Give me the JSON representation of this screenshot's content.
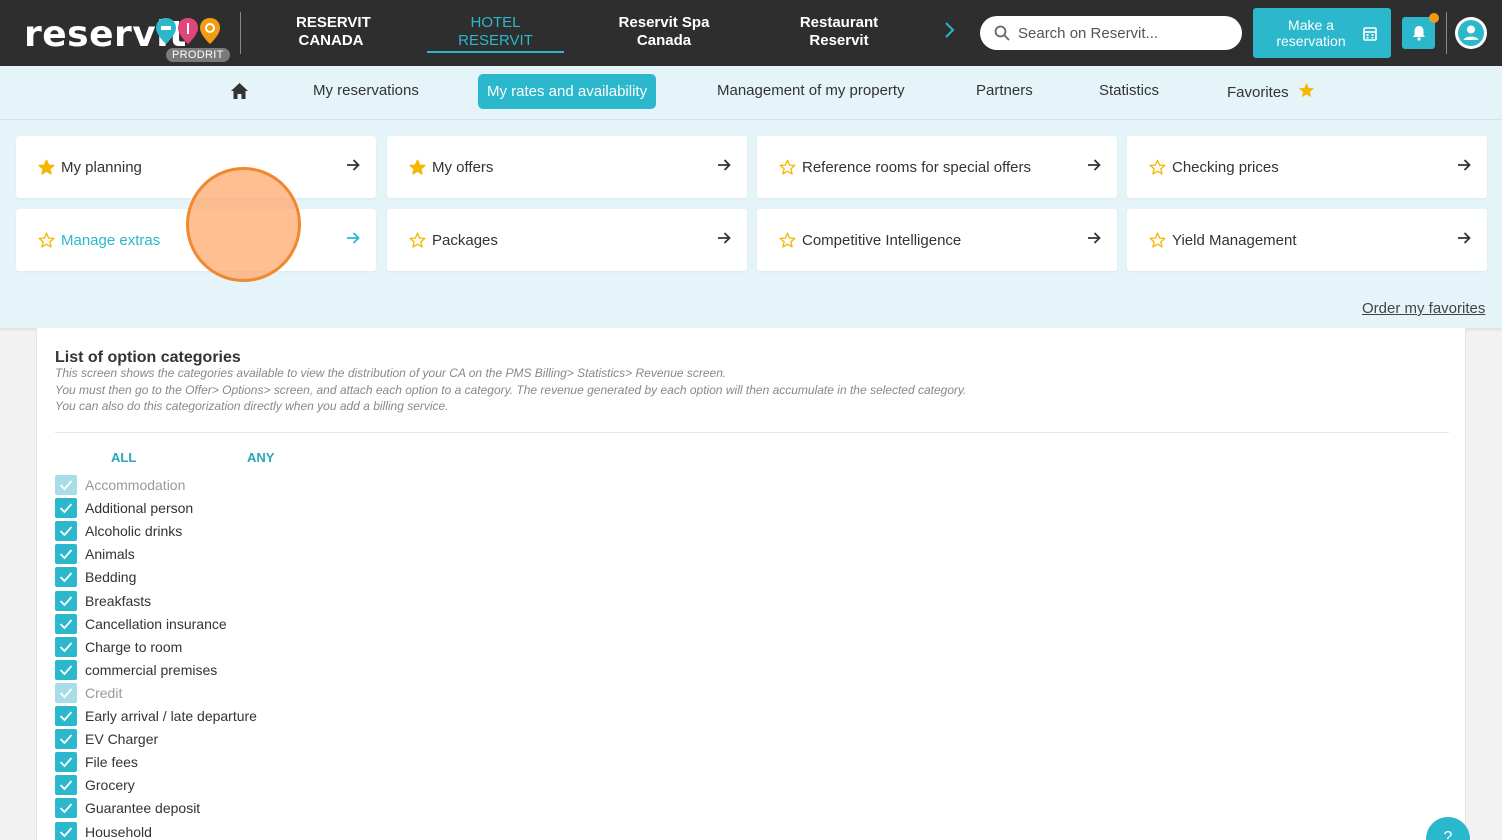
{
  "brand": {
    "logo_text": "reservit",
    "badge": "PRODRIT"
  },
  "top_nav": [
    {
      "line1": "RESERVIT",
      "line2": "CANADA"
    },
    {
      "line1": "HOTEL",
      "line2": "RESERVIT"
    },
    {
      "line1": "Reservit Spa",
      "line2": "Canada"
    },
    {
      "line1": "Restaurant",
      "line2": "Reservit"
    }
  ],
  "search": {
    "placeholder": "Search on Reservit..."
  },
  "make_reservation": {
    "line1": "Make a",
    "line2": "reservation"
  },
  "sub_nav": {
    "items": [
      "My reservations",
      "My rates and availability",
      "Management of my property",
      "Partners",
      "Statistics",
      "Favorites"
    ]
  },
  "favorites": {
    "cards": [
      {
        "label": "My planning",
        "starred": true
      },
      {
        "label": "My offers",
        "starred": true
      },
      {
        "label": "Reference rooms for special offers",
        "starred": false
      },
      {
        "label": "Checking prices",
        "starred": false
      },
      {
        "label": "Manage extras",
        "starred": false
      },
      {
        "label": "Packages",
        "starred": false
      },
      {
        "label": "Competitive Intelligence",
        "starred": false
      },
      {
        "label": "Yield Management",
        "starred": false
      }
    ],
    "order_link": "Order my favorites"
  },
  "content": {
    "title": "List of option categories",
    "description": [
      "This screen shows the categories available to view the distribution of your CA on the PMS Billing> Statistics> Revenue screen.",
      "You must then go to the Offer> Options> screen, and attach each option to a category. The revenue generated by each option will then accumulate in the selected category.",
      "You can also do this categorization directly when you add a billing service."
    ],
    "select_all": "ALL",
    "select_none": "ANY",
    "categories": [
      {
        "label": "Accommodation",
        "checked": true,
        "disabled": true
      },
      {
        "label": "Additional person",
        "checked": true,
        "disabled": false
      },
      {
        "label": "Alcoholic drinks",
        "checked": true,
        "disabled": false
      },
      {
        "label": "Animals",
        "checked": true,
        "disabled": false
      },
      {
        "label": "Bedding",
        "checked": true,
        "disabled": false
      },
      {
        "label": "Breakfasts",
        "checked": true,
        "disabled": false
      },
      {
        "label": "Cancellation insurance",
        "checked": true,
        "disabled": false
      },
      {
        "label": "Charge to room",
        "checked": true,
        "disabled": false
      },
      {
        "label": "commercial premises",
        "checked": true,
        "disabled": false
      },
      {
        "label": "Credit",
        "checked": true,
        "disabled": true
      },
      {
        "label": "Early arrival / late departure",
        "checked": true,
        "disabled": false
      },
      {
        "label": "EV Charger",
        "checked": true,
        "disabled": false
      },
      {
        "label": "File fees",
        "checked": true,
        "disabled": false
      },
      {
        "label": "Grocery",
        "checked": true,
        "disabled": false
      },
      {
        "label": "Guarantee deposit",
        "checked": true,
        "disabled": false
      },
      {
        "label": "Household",
        "checked": true,
        "disabled": false
      }
    ]
  },
  "help": {
    "label": "?"
  },
  "colors": {
    "accent": "#2bb7cc",
    "topbar": "#2e2e2e",
    "panel": "#e4f4f8",
    "star": "#f5b800",
    "cursor": "#f0882e"
  }
}
